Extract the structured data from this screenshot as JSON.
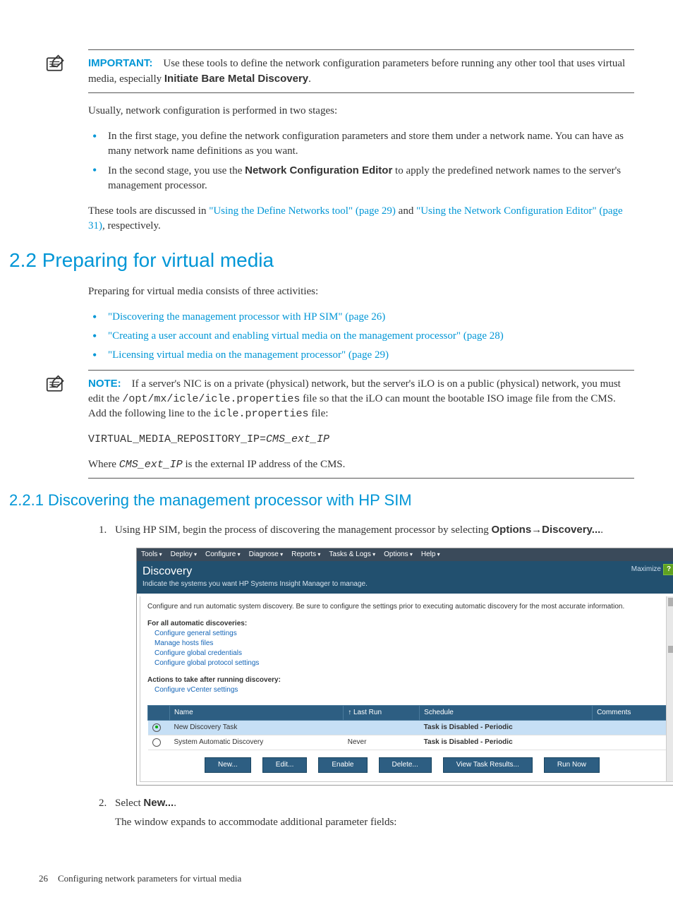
{
  "important": {
    "label": "IMPORTANT:",
    "text_a": "Use these tools to define the network configuration parameters before running any other tool that uses virtual media, especially ",
    "bold": "Initiate Bare Metal Discovery",
    "text_b": "."
  },
  "intro": "Usually, network configuration is performed in two stages:",
  "stage1": "In the first stage, you define the network configuration parameters and store them under a network name. You can have as many network name definitions as you want.",
  "stage2_a": "In the second stage, you use the ",
  "stage2_bold": "Network Configuration Editor",
  "stage2_b": " to apply the predefined network names to the server's management processor.",
  "tools_a": "These tools are discussed in ",
  "tools_link1": "\"Using the Define Networks tool\" (page 29)",
  "tools_mid": " and ",
  "tools_link2": "\"Using the Network Configuration Editor\" (page 31)",
  "tools_end": ", respectively.",
  "h1": "2.2 Preparing for virtual media",
  "prep_intro": "Preparing for virtual media consists of three activities:",
  "prep_li1": "\"Discovering the management processor with HP SIM\" (page 26)",
  "prep_li2": "\"Creating a user account and enabling virtual media on the management processor\" (page 28)",
  "prep_li3": "\"Licensing virtual media on the management processor\" (page 29)",
  "note": {
    "label": "NOTE:",
    "a": "If a server's NIC is on a private (physical) network, but the server's iLO is on a public (physical) network, you must edit the ",
    "path": "/opt/mx/icle/icle.properties",
    "b": " file so that the iLO can mount the bootable ISO image file from the CMS. Add the following line to the ",
    "file": "icle.properties",
    "c": " file:",
    "code_a": "VIRTUAL_MEDIA_REPOSITORY_IP=",
    "code_b": "CMS_ext_IP",
    "where_a": "Where ",
    "where_code": "CMS_ext_IP",
    "where_b": " is the external IP address of the CMS."
  },
  "h2": "2.2.1 Discovering the management processor with HP SIM",
  "step1_a": "Using HP SIM, begin the process of discovering the management processor by selecting ",
  "step1_b": "Options",
  "step1_arrow": "→",
  "step1_c": "Discovery...",
  "step1_d": ".",
  "ss": {
    "menus": [
      "Tools",
      "Deploy",
      "Configure",
      "Diagnose",
      "Reports",
      "Tasks & Logs",
      "Options",
      "Help"
    ],
    "title": "Discovery",
    "subtitle": "Indicate the systems you want HP Systems Insight Manager to manage.",
    "maximize": "Maximize",
    "help": "?",
    "desc": "Configure and run automatic system discovery. Be sure to configure the settings prior to executing automatic discovery for the most accurate information.",
    "groupA": "For all automatic discoveries:",
    "la1": "Configure general settings",
    "la2": "Manage hosts files",
    "la3": "Configure global credentials",
    "la4": "Configure global protocol settings",
    "groupB": "Actions to take after running discovery:",
    "lb1": "Configure vCenter settings",
    "th_name": "Name",
    "th_last": "Last Run",
    "th_sched": "Schedule",
    "th_comm": "Comments",
    "row1_name": "New Discovery Task",
    "row1_sched": "Task is Disabled - Periodic",
    "row2_name": "System Automatic Discovery",
    "row2_last": "Never",
    "row2_sched": "Task is Disabled - Periodic",
    "btns": [
      "New...",
      "Edit...",
      "Enable",
      "Delete...",
      "View Task Results...",
      "Run Now"
    ]
  },
  "step2_a": "Select ",
  "step2_b": "New...",
  "step2_c": ".",
  "step2_after": "The window expands to accommodate additional parameter fields:",
  "footer_page": "26",
  "footer_text": "Configuring network parameters for virtual media"
}
